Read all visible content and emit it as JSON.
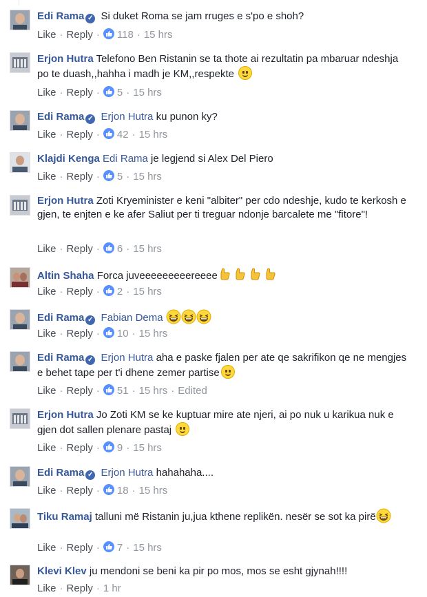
{
  "labels": {
    "like": "Like",
    "reply": "Reply",
    "separator": "·"
  },
  "colors": {
    "link": "#365899",
    "meta": "#90949c",
    "reaction": "#5890ff"
  },
  "comments": [
    {
      "author": "Edi Rama",
      "verified": true,
      "tag": "",
      "text": "Si duket Roma se jam rruges e s'po e shoh?",
      "emoji": [],
      "likes": "118",
      "time": "15 hrs",
      "edited": "",
      "avatar_icon": "avatar-edi-rama-icon"
    },
    {
      "author": "Erjon Hutra",
      "verified": false,
      "tag": "",
      "text": "Telefono Ben Ristanin se ta thote ai rezultatin pa mbaruar ndeshja po te duash,,hahha i madh je KM,,respekte",
      "emoji": [
        "smile"
      ],
      "likes": "5",
      "time": "15 hrs",
      "edited": "",
      "avatar_icon": "avatar-erjon-hutra-icon"
    },
    {
      "author": "Edi Rama",
      "verified": true,
      "tag": "Erjon Hutra",
      "text": " ku punon ky?",
      "emoji": [],
      "likes": "42",
      "time": "15 hrs",
      "edited": "",
      "avatar_icon": "avatar-edi-rama-icon"
    },
    {
      "author": "Klajdi Kenga",
      "verified": false,
      "tag": "Edi Rama",
      "text": " je legjend si Alex Del Piero",
      "emoji": [],
      "likes": "5",
      "time": "15 hrs",
      "edited": "",
      "avatar_icon": "avatar-klajdi-kenga-icon"
    },
    {
      "author": "Erjon Hutra",
      "verified": false,
      "tag": "",
      "text": "Zoti Kryeminister e keni \"albiter\" per cdo ndeshje, kudo te kerkosh e gjen, te enjten e ke afer Saliut per ti treguar ndonje barcalete me \"fitore\"!",
      "emoji": [],
      "likes": "6",
      "time": "15 hrs",
      "edited": "",
      "avatar_icon": "avatar-erjon-hutra-icon"
    },
    {
      "author": "Altin Shaha",
      "verified": false,
      "tag": "",
      "text": "Forca juveeeeeeeeereeee",
      "emoji": [
        "point",
        "point",
        "point",
        "point"
      ],
      "likes": "2",
      "time": "15 hrs",
      "edited": "",
      "avatar_icon": "avatar-altin-shaha-icon"
    },
    {
      "author": "Edi Rama",
      "verified": true,
      "tag": "Fabian Dema",
      "text": " ",
      "emoji": [
        "laugh",
        "laugh",
        "laugh"
      ],
      "likes": "10",
      "time": "15 hrs",
      "edited": "",
      "avatar_icon": "avatar-edi-rama-icon"
    },
    {
      "author": "Edi Rama",
      "verified": true,
      "tag": "Erjon Hutra",
      "text": " aha e paske fjalen per ate qe sakrifikon qe ne mengjes e behet tape per t'i dhene zemer partise",
      "emoji": [
        "smile"
      ],
      "likes": "51",
      "time": "15 hrs",
      "edited": "Edited",
      "avatar_icon": "avatar-edi-rama-icon"
    },
    {
      "author": "Erjon Hutra",
      "verified": false,
      "tag": "",
      "text": "Jo Zoti KM se ke kuptuar mire ate njeri, ai po nuk u karikua nuk e gjen dot sallen plenare pastaj ",
      "emoji": [
        "smile"
      ],
      "likes": "9",
      "time": "15 hrs",
      "edited": "",
      "avatar_icon": "avatar-erjon-hutra-icon"
    },
    {
      "author": "Edi Rama",
      "verified": true,
      "tag": "Erjon Hutra",
      "text": " hahahaha....",
      "emoji": [],
      "likes": "18",
      "time": "15 hrs",
      "edited": "",
      "avatar_icon": "avatar-edi-rama-icon"
    },
    {
      "author": "Tiku Ramaj",
      "verified": false,
      "tag": "",
      "text": "talluni më Ristanin ju,jua kthene replikën. nesër se sot ka pirë",
      "emoji": [
        "laugh"
      ],
      "likes": "7",
      "time": "15 hrs",
      "edited": "",
      "avatar_icon": "avatar-tiku-ramaj-icon"
    },
    {
      "author": "Klevi Klev",
      "verified": false,
      "tag": "",
      "text": "ju mendoni se beni ka pir po mos, mos se esht gjynah!!!!",
      "emoji": [],
      "likes": "",
      "time": "1 hr",
      "edited": "",
      "avatar_icon": "avatar-klevi-klev-icon"
    }
  ]
}
